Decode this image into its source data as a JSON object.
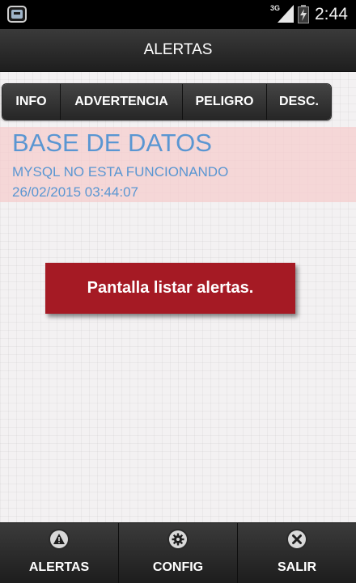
{
  "status_bar": {
    "network": "3G",
    "time": "2:44"
  },
  "header": {
    "title": "ALERTAS"
  },
  "tabs": [
    {
      "label": "INFO"
    },
    {
      "label": "ADVERTENCIA"
    },
    {
      "label": "PELIGRO"
    },
    {
      "label": "DESC."
    }
  ],
  "alerts": [
    {
      "title": "BASE DE DATOS",
      "message": "MYSQL NO ESTA FUNCIONANDO",
      "timestamp": "26/02/2015 03:44:07"
    }
  ],
  "toast": {
    "text": "Pantalla listar alertas."
  },
  "bottom_nav": [
    {
      "label": "ALERTAS",
      "icon": "warning-icon"
    },
    {
      "label": "CONFIG",
      "icon": "gear-icon"
    },
    {
      "label": "SALIR",
      "icon": "close-icon"
    }
  ],
  "colors": {
    "alert_text": "#5a96d2",
    "alert_bg": "#f5cdcd",
    "toast_bg": "#a51a24",
    "bar_bg": "#2a2a2a"
  }
}
